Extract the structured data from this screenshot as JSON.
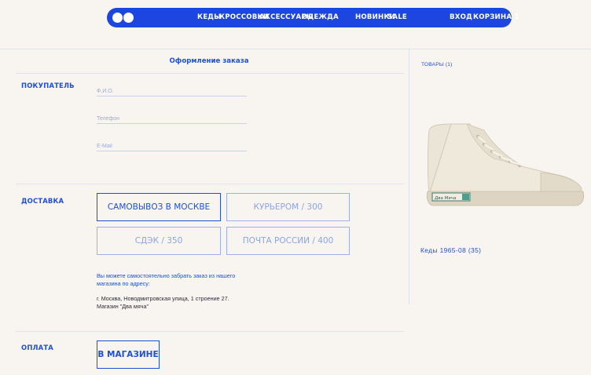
{
  "header": {
    "nav": [
      "КЕДЫ",
      "КРОССОВКИ",
      "АКСЕССУАРЫ",
      "ОДЕЖДА"
    ],
    "nav2": [
      "НОВИНКИ",
      "SALE"
    ],
    "login": "ВХОД",
    "cart": "КОРЗИНА 1"
  },
  "page_title": "Оформление заказа",
  "buyer": {
    "label": "ПОКУПАТЕЛЬ",
    "fields": [
      {
        "placeholder": "Ф.И.О.",
        "value": ""
      },
      {
        "placeholder": "Телефон",
        "value": ""
      },
      {
        "placeholder": "E-Mail",
        "value": ""
      }
    ]
  },
  "delivery": {
    "label": "ДОСТАВКА",
    "options": [
      "САМОВЫВОЗ В МОСКВЕ",
      "КУРЬЕРОМ / 300",
      "СДЭК / 350",
      "ПОЧТА РОССИИ / 400"
    ],
    "selected": "САМОВЫВОЗ В МОСКВЕ",
    "note_line1": "Вы можете самостоятельно забрать заказ из нашего",
    "note_line2": "магазина по адресу:",
    "address_line1": "г. Москва, Новодмитровская улица, 1 строение 27.",
    "address_line2": "Магазин \"Два мяча\""
  },
  "payment": {
    "label": "ОПЛАТА",
    "options": [
      "В МАГАЗИНЕ"
    ]
  },
  "cart_panel": {
    "label": "ТОВАРЫ (1)",
    "product_name": "Кеды 1965-08 (35)",
    "shoe_badge": "Два Мяча"
  },
  "colors": {
    "accent": "#1d46e0",
    "text": "#1f4fd6",
    "background": "#f8f5f1"
  }
}
